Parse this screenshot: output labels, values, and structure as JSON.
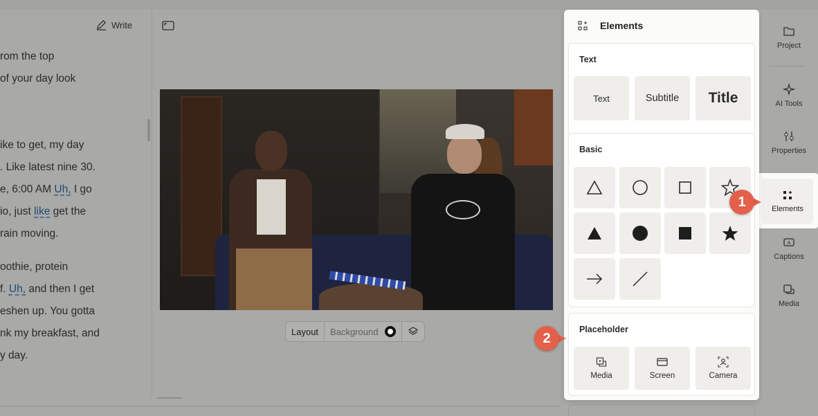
{
  "script": {
    "write_label": "Write",
    "lines": [
      "rom the top",
      "of your day look",
      "",
      "",
      "ike to get, my day",
      ". Like latest nine 30.",
      "e, 6:00 AM Uh, I go",
      "io, just like get the",
      "rain moving.",
      "",
      "oothie, protein",
      "f. Uh, and then I get",
      "eshen up. You gotta",
      "nk my breakfast, and",
      "y day."
    ]
  },
  "canvas": {
    "layout_label": "Layout",
    "background_label": "Background"
  },
  "sidebar": {
    "items": [
      {
        "label": "Project",
        "icon": "folder-icon"
      },
      {
        "label": "AI Tools",
        "icon": "sparkle-icon"
      },
      {
        "label": "Properties",
        "icon": "sliders-icon"
      },
      {
        "label": "Elements",
        "icon": "elements-icon",
        "active": true
      },
      {
        "label": "Captions",
        "icon": "captions-icon"
      },
      {
        "label": "Media",
        "icon": "media-icon"
      }
    ]
  },
  "panel": {
    "title": "Elements",
    "text_section": {
      "title": "Text",
      "tiles": [
        "Text",
        "Subtitle",
        "Title"
      ]
    },
    "basic_section": {
      "title": "Basic",
      "shapes": [
        "triangle-outline",
        "circle-outline",
        "square-outline",
        "star-outline",
        "triangle-filled",
        "circle-filled",
        "square-filled",
        "star-filled",
        "arrow",
        "line"
      ]
    },
    "placeholder_section": {
      "title": "Placeholder",
      "tiles": [
        {
          "label": "Media",
          "icon": "media-placeholder-icon"
        },
        {
          "label": "Screen",
          "icon": "screen-icon"
        },
        {
          "label": "Camera",
          "icon": "camera-icon"
        }
      ]
    }
  },
  "callouts": [
    "1",
    "2"
  ],
  "colors": {
    "callout": "#e4604a",
    "overlay_dim": "#a9a9a7",
    "panel_bg": "#fbfbfa",
    "tile_bg": "#efeeeb",
    "filler_word": "#1f4a70"
  }
}
